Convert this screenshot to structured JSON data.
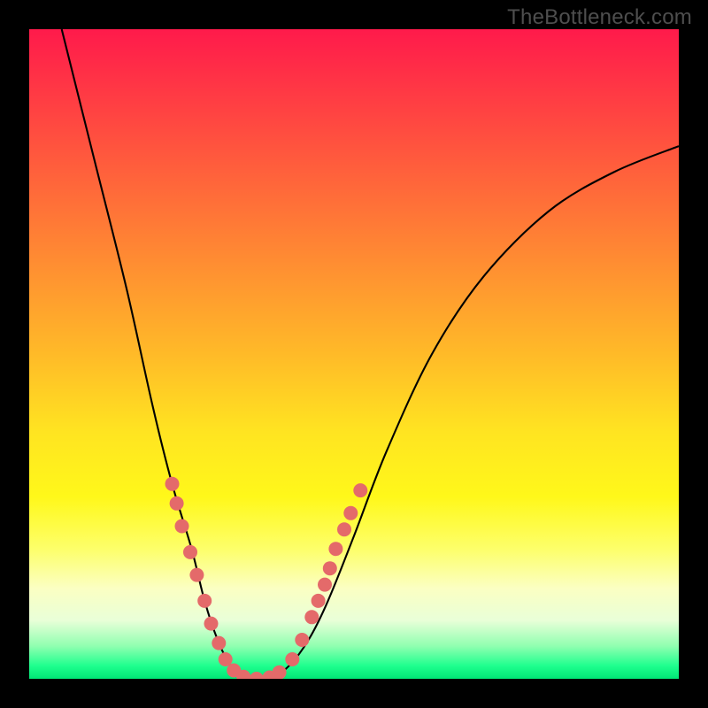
{
  "watermark": "TheBottleneck.com",
  "chart_data": {
    "type": "line",
    "title": "",
    "xlabel": "",
    "ylabel": "",
    "xlim": [
      0,
      100
    ],
    "ylim": [
      0,
      100
    ],
    "gradient_stops": [
      {
        "pct": 0,
        "color": "#ff1a4b"
      },
      {
        "pct": 10,
        "color": "#ff3a44"
      },
      {
        "pct": 20,
        "color": "#ff5a3d"
      },
      {
        "pct": 30,
        "color": "#ff7a36"
      },
      {
        "pct": 40,
        "color": "#ff9a2f"
      },
      {
        "pct": 50,
        "color": "#ffba28"
      },
      {
        "pct": 62,
        "color": "#ffe421"
      },
      {
        "pct": 72,
        "color": "#fff81a"
      },
      {
        "pct": 80,
        "color": "#fdff6a"
      },
      {
        "pct": 86,
        "color": "#fbffc2"
      },
      {
        "pct": 91,
        "color": "#e9ffd8"
      },
      {
        "pct": 95,
        "color": "#8fffb0"
      },
      {
        "pct": 98,
        "color": "#1fff8e"
      },
      {
        "pct": 100,
        "color": "#00e676"
      }
    ],
    "series": [
      {
        "name": "bottleneck-curve",
        "color": "#000000",
        "x": [
          5,
          10,
          15,
          19,
          22,
          25,
          27,
          29,
          31,
          33,
          35,
          37,
          40,
          43,
          46,
          50,
          55,
          62,
          70,
          80,
          90,
          100
        ],
        "y": [
          100,
          80,
          60,
          42,
          30,
          20,
          12,
          6,
          2,
          0,
          0,
          0,
          2,
          6,
          12,
          22,
          35,
          50,
          62,
          72,
          78,
          82
        ]
      }
    ],
    "highlight_dots": {
      "color": "#e46a6a",
      "radius_px": 8,
      "points": [
        {
          "x": 22,
          "y": 30
        },
        {
          "x": 22.7,
          "y": 27
        },
        {
          "x": 23.5,
          "y": 23.5
        },
        {
          "x": 24.8,
          "y": 19.5
        },
        {
          "x": 25.8,
          "y": 16
        },
        {
          "x": 27,
          "y": 12
        },
        {
          "x": 28,
          "y": 8.5
        },
        {
          "x": 29.2,
          "y": 5.5
        },
        {
          "x": 30.2,
          "y": 3
        },
        {
          "x": 31.5,
          "y": 1.3
        },
        {
          "x": 33,
          "y": 0.3
        },
        {
          "x": 35,
          "y": 0
        },
        {
          "x": 37,
          "y": 0.2
        },
        {
          "x": 38.5,
          "y": 1
        },
        {
          "x": 40.5,
          "y": 3
        },
        {
          "x": 42,
          "y": 6
        },
        {
          "x": 43.5,
          "y": 9.5
        },
        {
          "x": 44.5,
          "y": 12
        },
        {
          "x": 45.5,
          "y": 14.5
        },
        {
          "x": 46.3,
          "y": 17
        },
        {
          "x": 47.2,
          "y": 20
        },
        {
          "x": 48.5,
          "y": 23
        },
        {
          "x": 49.5,
          "y": 25.5
        },
        {
          "x": 51,
          "y": 29
        }
      ]
    }
  }
}
